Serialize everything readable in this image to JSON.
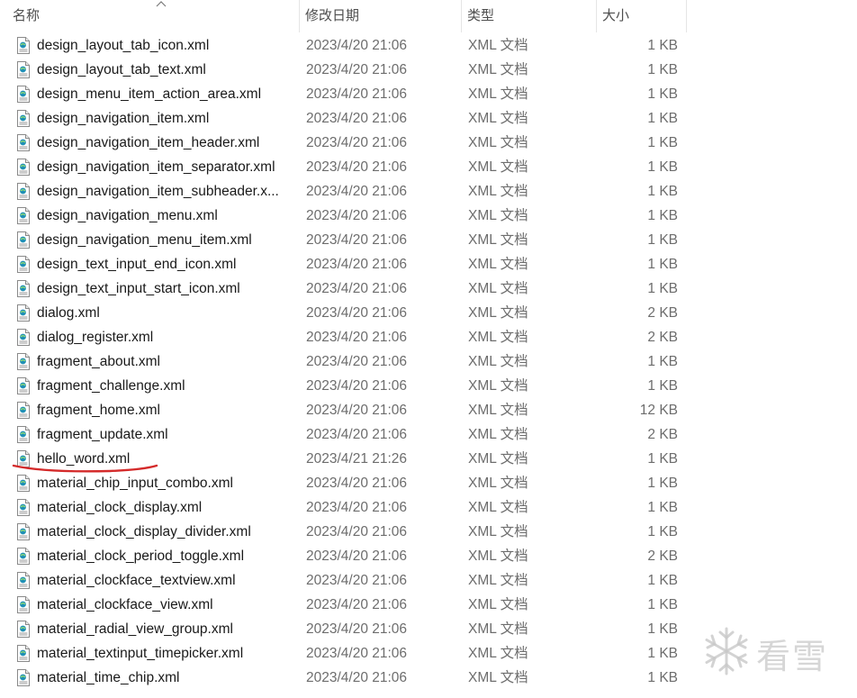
{
  "columns": {
    "name": "名称",
    "date": "修改日期",
    "type": "类型",
    "size": "大小"
  },
  "files": [
    {
      "name": "design_layout_tab_icon.xml",
      "date": "2023/4/20 21:06",
      "type": "XML 文档",
      "size": "1 KB"
    },
    {
      "name": "design_layout_tab_text.xml",
      "date": "2023/4/20 21:06",
      "type": "XML 文档",
      "size": "1 KB"
    },
    {
      "name": "design_menu_item_action_area.xml",
      "date": "2023/4/20 21:06",
      "type": "XML 文档",
      "size": "1 KB"
    },
    {
      "name": "design_navigation_item.xml",
      "date": "2023/4/20 21:06",
      "type": "XML 文档",
      "size": "1 KB"
    },
    {
      "name": "design_navigation_item_header.xml",
      "date": "2023/4/20 21:06",
      "type": "XML 文档",
      "size": "1 KB"
    },
    {
      "name": "design_navigation_item_separator.xml",
      "date": "2023/4/20 21:06",
      "type": "XML 文档",
      "size": "1 KB"
    },
    {
      "name": "design_navigation_item_subheader.x...",
      "date": "2023/4/20 21:06",
      "type": "XML 文档",
      "size": "1 KB"
    },
    {
      "name": "design_navigation_menu.xml",
      "date": "2023/4/20 21:06",
      "type": "XML 文档",
      "size": "1 KB"
    },
    {
      "name": "design_navigation_menu_item.xml",
      "date": "2023/4/20 21:06",
      "type": "XML 文档",
      "size": "1 KB"
    },
    {
      "name": "design_text_input_end_icon.xml",
      "date": "2023/4/20 21:06",
      "type": "XML 文档",
      "size": "1 KB"
    },
    {
      "name": "design_text_input_start_icon.xml",
      "date": "2023/4/20 21:06",
      "type": "XML 文档",
      "size": "1 KB"
    },
    {
      "name": "dialog.xml",
      "date": "2023/4/20 21:06",
      "type": "XML 文档",
      "size": "2 KB"
    },
    {
      "name": "dialog_register.xml",
      "date": "2023/4/20 21:06",
      "type": "XML 文档",
      "size": "2 KB"
    },
    {
      "name": "fragment_about.xml",
      "date": "2023/4/20 21:06",
      "type": "XML 文档",
      "size": "1 KB"
    },
    {
      "name": "fragment_challenge.xml",
      "date": "2023/4/20 21:06",
      "type": "XML 文档",
      "size": "1 KB"
    },
    {
      "name": "fragment_home.xml",
      "date": "2023/4/20 21:06",
      "type": "XML 文档",
      "size": "12 KB"
    },
    {
      "name": "fragment_update.xml",
      "date": "2023/4/20 21:06",
      "type": "XML 文档",
      "size": "2 KB"
    },
    {
      "name": "hello_word.xml",
      "date": "2023/4/21 21:26",
      "type": "XML 文档",
      "size": "1 KB"
    },
    {
      "name": "material_chip_input_combo.xml",
      "date": "2023/4/20 21:06",
      "type": "XML 文档",
      "size": "1 KB"
    },
    {
      "name": "material_clock_display.xml",
      "date": "2023/4/20 21:06",
      "type": "XML 文档",
      "size": "1 KB"
    },
    {
      "name": "material_clock_display_divider.xml",
      "date": "2023/4/20 21:06",
      "type": "XML 文档",
      "size": "1 KB"
    },
    {
      "name": "material_clock_period_toggle.xml",
      "date": "2023/4/20 21:06",
      "type": "XML 文档",
      "size": "2 KB"
    },
    {
      "name": "material_clockface_textview.xml",
      "date": "2023/4/20 21:06",
      "type": "XML 文档",
      "size": "1 KB"
    },
    {
      "name": "material_clockface_view.xml",
      "date": "2023/4/20 21:06",
      "type": "XML 文档",
      "size": "1 KB"
    },
    {
      "name": "material_radial_view_group.xml",
      "date": "2023/4/20 21:06",
      "type": "XML 文档",
      "size": "1 KB"
    },
    {
      "name": "material_textinput_timepicker.xml",
      "date": "2023/4/20 21:06",
      "type": "XML 文档",
      "size": "1 KB"
    },
    {
      "name": "material_time_chip.xml",
      "date": "2023/4/20 21:06",
      "type": "XML 文档",
      "size": "1 KB"
    }
  ],
  "icon": "xml-file-icon",
  "sort_icon": "sort-up-icon",
  "highlighted_file": "hello_word.xml",
  "annotation_color": "#d42a2a",
  "watermark": {
    "text": "看雪",
    "icon": "snowflake-icon"
  }
}
